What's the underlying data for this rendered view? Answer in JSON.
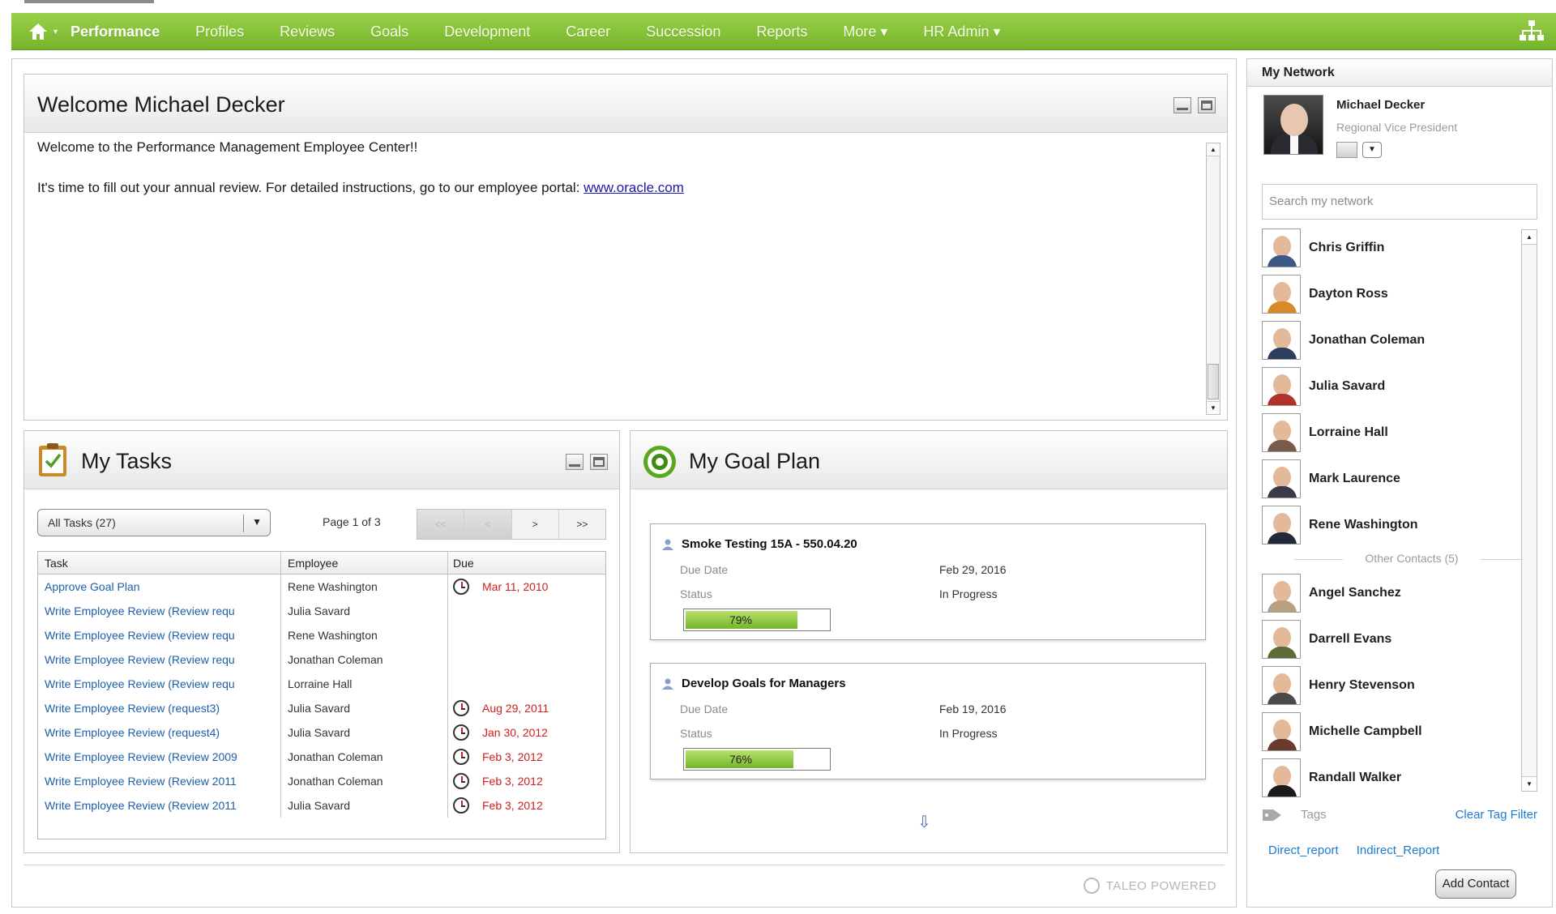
{
  "nav": {
    "items": [
      "Performance",
      "Profiles",
      "Reviews",
      "Goals",
      "Development",
      "Career",
      "Succession",
      "Reports",
      "More ▾",
      "HR Admin ▾"
    ],
    "home_caret": "▾",
    "accent": "#7ab82e"
  },
  "welcome": {
    "title": "Welcome Michael Decker",
    "line1": "Welcome to the Performance Management Employee Center!!",
    "line2": "It's time to fill out your annual review. For detailed instructions, go to our employee portal:",
    "link": "www.oracle.com"
  },
  "tasks": {
    "title": "My Tasks",
    "filter": "All Tasks (27)",
    "page_info": "Page 1 of 3",
    "pager": [
      "<<",
      "<",
      ">",
      ">>"
    ],
    "columns": [
      "Task",
      "Employee",
      "Due"
    ],
    "rows": [
      {
        "task": "Approve Goal Plan",
        "employee": "Rene Washington",
        "due": "Mar 11, 2010"
      },
      {
        "task": "Write Employee Review (Review requ",
        "employee": "Julia Savard",
        "due": ""
      },
      {
        "task": "Write Employee Review (Review requ",
        "employee": "Rene Washington",
        "due": ""
      },
      {
        "task": "Write Employee Review (Review requ",
        "employee": "Jonathan Coleman",
        "due": ""
      },
      {
        "task": "Write Employee Review (Review requ",
        "employee": "Lorraine Hall",
        "due": ""
      },
      {
        "task": "Write Employee Review (request3)",
        "employee": "Julia Savard",
        "due": "Aug 29, 2011"
      },
      {
        "task": "Write Employee Review (request4)",
        "employee": "Julia Savard",
        "due": "Jan 30, 2012"
      },
      {
        "task": "Write Employee Review (Review 2009",
        "employee": "Jonathan Coleman",
        "due": "Feb 3, 2012"
      },
      {
        "task": "Write Employee Review (Review 2011",
        "employee": "Jonathan Coleman",
        "due": "Feb 3, 2012"
      },
      {
        "task": "Write Employee Review (Review 2011",
        "employee": "Julia Savard",
        "due": "Feb 3, 2012"
      }
    ]
  },
  "goals": {
    "title": "My Goal Plan",
    "items": [
      {
        "name": "Smoke Testing 15A - 550.04.20",
        "due_label": "Due Date",
        "due": "Feb 29, 2016",
        "status_label": "Status",
        "status": "In Progress",
        "progress_text": "79%",
        "progress": 79
      },
      {
        "name": "Develop Goals for Managers",
        "due_label": "Due Date",
        "due": "Feb 19, 2016",
        "status_label": "Status",
        "status": "In Progress",
        "progress_text": "76%",
        "progress": 76
      }
    ]
  },
  "footer": {
    "brand": "TALEO POWERED"
  },
  "network": {
    "title": "My Network",
    "me": {
      "name": "Michael Decker",
      "role": "Regional Vice President"
    },
    "search_placeholder": "Search my network",
    "contacts": [
      {
        "name": "Chris Griffin",
        "color": "#3d5a86"
      },
      {
        "name": "Dayton Ross",
        "color": "#d88a2a"
      },
      {
        "name": "Jonathan Coleman",
        "color": "#2d3e5e"
      },
      {
        "name": "Julia Savard",
        "color": "#b0322a"
      },
      {
        "name": "Lorraine Hall",
        "color": "#7a5a4a"
      },
      {
        "name": "Mark Laurence",
        "color": "#3a3a48"
      },
      {
        "name": "Rene Washington",
        "color": "#222a3a"
      }
    ],
    "other_label": "Other Contacts (5)",
    "others": [
      {
        "name": "Angel Sanchez",
        "color": "#b8a080"
      },
      {
        "name": "Darrell Evans",
        "color": "#5e6a3a"
      },
      {
        "name": "Henry Stevenson",
        "color": "#4a4a4a"
      },
      {
        "name": "Michelle Campbell",
        "color": "#6a3a2a"
      },
      {
        "name": "Randall Walker",
        "color": "#1a1a1a"
      }
    ],
    "tags_label": "Tags",
    "clear_tag": "Clear Tag Filter",
    "tag_links": [
      "Direct_report",
      "Indirect_Report"
    ],
    "add_contact": "Add Contact"
  }
}
